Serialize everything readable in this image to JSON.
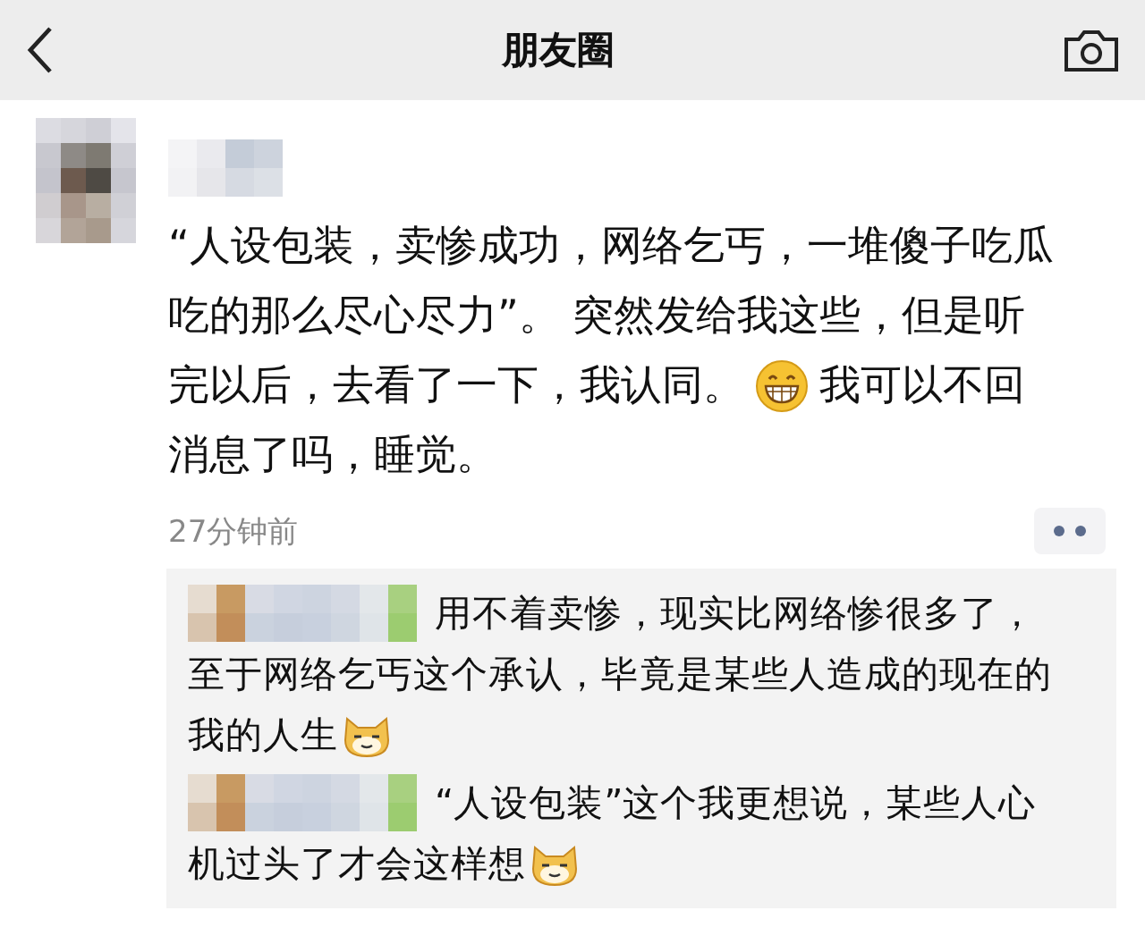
{
  "header": {
    "title": "朋友圈"
  },
  "post": {
    "lines": [
      [
        {
          "kind": "text",
          "text": "“人设包装，卖惨成功，网络乞丐，一堆傻子吃瓜"
        }
      ],
      [
        {
          "kind": "text",
          "text": "吃的那么尽心尽力”。 突然发给我这些，但是听"
        }
      ],
      [
        {
          "kind": "text",
          "text": "完以后，去看了一下，我认同。"
        },
        {
          "kind": "grin"
        },
        {
          "kind": "text",
          "text": "我可以不回"
        }
      ],
      [
        {
          "kind": "text",
          "text": "消息了吗，睡觉。"
        }
      ]
    ],
    "time": "27分钟前"
  },
  "comments": [
    {
      "lines": [
        [
          {
            "kind": "text",
            "text": "用不着卖惨，现实比网络惨很多了，"
          }
        ],
        [
          {
            "kind": "text",
            "text": "至于网络乞丐这个承认，毕竟是某些人造成的现在的"
          }
        ],
        [
          {
            "kind": "text",
            "text": "我的人生"
          },
          {
            "kind": "doge"
          }
        ]
      ]
    },
    {
      "lines": [
        [
          {
            "kind": "text",
            "text": "“人设包装”这个我更想说，某些人心"
          }
        ],
        [
          {
            "kind": "text",
            "text": "机过头了才会这样想"
          },
          {
            "kind": "doge"
          }
        ]
      ]
    }
  ]
}
